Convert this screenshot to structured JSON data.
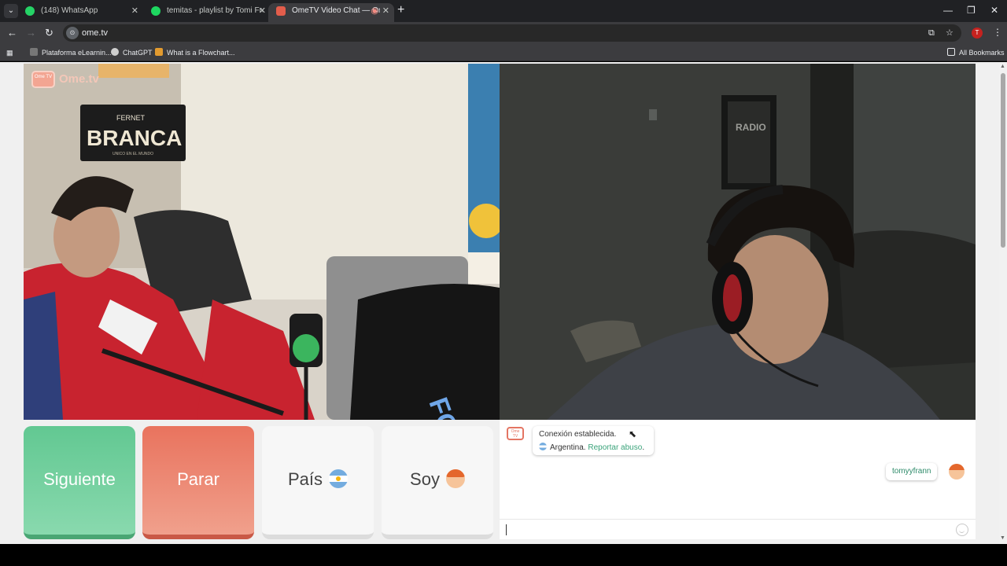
{
  "browser": {
    "tabs": [
      {
        "label": "(148) WhatsApp",
        "color": "#25d366"
      },
      {
        "label": "temitas - playlist by Tomi Franc",
        "color": "#1ed760"
      },
      {
        "label": "OmeTV Video Chat — Ome",
        "color": "#e35d4b"
      }
    ],
    "active_tab_index": 2,
    "url": "ome.tv",
    "bookmarks": [
      {
        "label": "Plataforma eLearnin..."
      },
      {
        "label": "ChatGPT"
      },
      {
        "label": "What is a Flowchart..."
      }
    ],
    "all_bookmarks_label": "All Bookmarks",
    "profile_initial": "T"
  },
  "site": {
    "logo_badge": "Ome TV",
    "logo_text": "Ome.tv"
  },
  "videos": {
    "left": {
      "sign_top": "FERNET",
      "sign_main": "BRANCA",
      "sign_sub": "UNICO EN EL MUNDO"
    },
    "right": {
      "poster": "RADIO"
    }
  },
  "controls": {
    "next_label": "Siguiente",
    "stop_label": "Parar",
    "country_label": "País",
    "gender_label": "Soy"
  },
  "chat": {
    "system_message": "Conexión establecida.",
    "country": "Argentina.",
    "report_link": "Reportar abuso",
    "report_suffix": ".",
    "username": "tomyyfrann"
  }
}
